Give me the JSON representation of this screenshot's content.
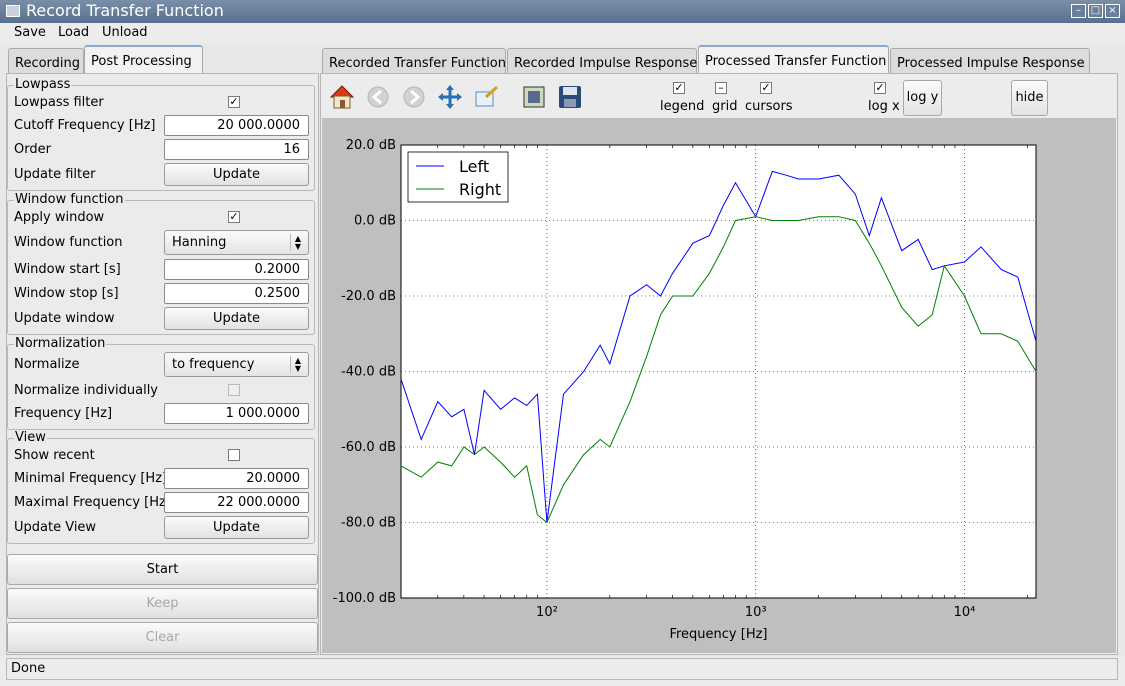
{
  "window": {
    "title": "Record Transfer Function"
  },
  "menu": [
    "Save",
    "Load",
    "Unload"
  ],
  "left_tabs": [
    "Recording",
    "Post Processing"
  ],
  "right_tabs": [
    "Recorded Transfer Function",
    "Recorded Impulse Response",
    "Processed Transfer Function",
    "Processed Impulse Response"
  ],
  "lowpass": {
    "title": "Lowpass",
    "filter_label": "Lowpass filter",
    "filter_checked": "✓",
    "cutoff_label": "Cutoff Frequency [Hz]",
    "cutoff_value": "20 000.0000",
    "order_label": "Order",
    "order_value": "16",
    "update_label": "Update filter",
    "update_button": "Update"
  },
  "window_function": {
    "title": "Window function",
    "apply_label": "Apply window",
    "apply_checked": "✓",
    "function_label": "Window function",
    "function_value": "Hanning",
    "start_label": "Window start [s]",
    "start_value": "0.2000",
    "stop_label": "Window stop [s]",
    "stop_value": "0.2500",
    "update_label": "Update window",
    "update_button": "Update"
  },
  "normalization": {
    "title": "Normalization",
    "normalize_label": "Normalize",
    "normalize_value": "to frequency",
    "individually_label": "Normalize individually",
    "frequency_label": "Frequency [Hz]",
    "frequency_value": "1 000.0000"
  },
  "view": {
    "title": "View",
    "recent_label": "Show recent",
    "min_label": "Minimal Frequency [Hz]",
    "min_value": "20.0000",
    "max_label": "Maximal Frequency [Hz]",
    "max_value": "22 000.0000",
    "update_label": "Update View",
    "update_button": "Update"
  },
  "actions": {
    "start": "Start",
    "keep": "Keep",
    "clear": "Clear"
  },
  "toolbar": {
    "legend": "legend",
    "grid": "grid",
    "cursors": "cursors",
    "logx": "log x",
    "logy": "log y",
    "hide": "hide",
    "legend_checked": "✓",
    "cursors_checked": "✓",
    "logx_checked": "✓",
    "grid_state": "–"
  },
  "status": "Done",
  "chart_data": {
    "type": "line",
    "xlabel": "Frequency [Hz]",
    "ylabel": "",
    "x_scale": "log",
    "xlim": [
      20,
      22000
    ],
    "ylim": [
      -100,
      20
    ],
    "x_ticks": [
      {
        "value": 100,
        "label": "10²"
      },
      {
        "value": 1000,
        "label": "10³"
      },
      {
        "value": 10000,
        "label": "10⁴"
      }
    ],
    "y_ticks": [
      {
        "value": 20,
        "label": "20.0 dB"
      },
      {
        "value": 0,
        "label": "0.0 dB"
      },
      {
        "value": -20,
        "label": "-20.0 dB"
      },
      {
        "value": -40,
        "label": "-40.0 dB"
      },
      {
        "value": -60,
        "label": "-60.0 dB"
      },
      {
        "value": -80,
        "label": "-80.0 dB"
      },
      {
        "value": -100,
        "label": "-100.0 dB"
      }
    ],
    "grid": true,
    "legend_position": "top-left",
    "series": [
      {
        "name": "Left",
        "color": "#0000ff",
        "x": [
          20,
          25,
          30,
          35,
          40,
          45,
          50,
          60,
          70,
          80,
          90,
          100,
          120,
          150,
          180,
          200,
          250,
          300,
          350,
          400,
          500,
          600,
          700,
          800,
          1000,
          1200,
          1400,
          1600,
          2000,
          2500,
          3000,
          3500,
          4000,
          5000,
          6000,
          7000,
          8000,
          10000,
          12000,
          15000,
          18000,
          22000
        ],
        "y": [
          -42,
          -58,
          -48,
          -52,
          -50,
          -62,
          -45,
          -50,
          -47,
          -49,
          -46,
          -80,
          -46,
          -40,
          -33,
          -38,
          -20,
          -17,
          -20,
          -14,
          -6,
          -4,
          4,
          10,
          1,
          13,
          12,
          11,
          11,
          12,
          7,
          -4,
          6,
          -8,
          -5,
          -13,
          -12,
          -11,
          -7,
          -13,
          -15,
          -32
        ]
      },
      {
        "name": "Right",
        "color": "#007f00",
        "x": [
          20,
          25,
          30,
          35,
          40,
          45,
          50,
          60,
          70,
          80,
          90,
          100,
          120,
          150,
          180,
          200,
          250,
          300,
          350,
          400,
          500,
          600,
          700,
          800,
          1000,
          1200,
          1400,
          1600,
          2000,
          2500,
          3000,
          3500,
          4000,
          5000,
          6000,
          7000,
          8000,
          10000,
          12000,
          15000,
          18000,
          22000
        ],
        "y": [
          -65,
          -68,
          -64,
          -65,
          -60,
          -62,
          -60,
          -64,
          -68,
          -65,
          -78,
          -80,
          -70,
          -62,
          -58,
          -60,
          -48,
          -36,
          -25,
          -20,
          -20,
          -14,
          -7,
          0,
          1,
          0,
          0,
          0,
          1,
          1,
          0,
          -6,
          -12,
          -23,
          -28,
          -25,
          -12,
          -20,
          -30,
          -30,
          -32,
          -40
        ]
      }
    ]
  }
}
